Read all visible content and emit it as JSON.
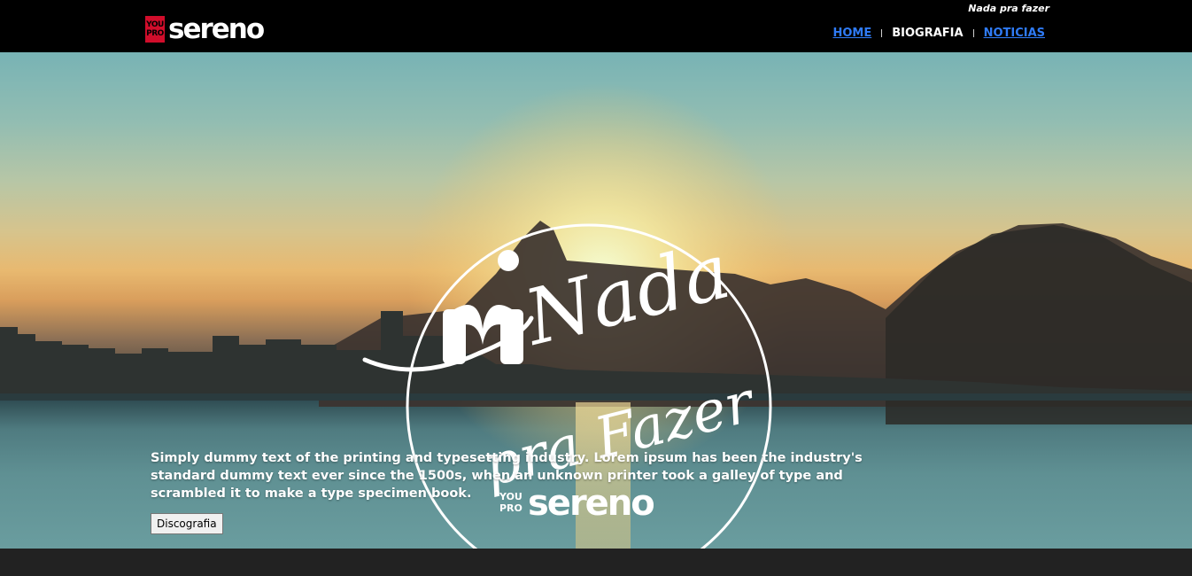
{
  "header": {
    "logo": {
      "badge_top": "YOU",
      "badge_bottom": "PRO",
      "wordmark": "sereno"
    },
    "tagline": "Nada pra fazer",
    "nav": [
      {
        "label": "HOME"
      },
      {
        "label": "BIOGRAFIA"
      },
      {
        "label": "NOTICIAS"
      }
    ]
  },
  "hero": {
    "emblem": {
      "title_line1": "Nada",
      "title_line2": "pra Fazer",
      "badge_top": "YOU",
      "badge_bottom": "PRO",
      "wordmark": "sereno"
    },
    "description": "Simply dummy text of the printing and typesetting industry. Lorem ipsum has been the industry's standard dummy text ever since the 1500s, when an unknown printer took a galley of type and scrambled it to make a type specimen book.",
    "button_label": "Discografia"
  },
  "colors": {
    "header_bg": "#000000",
    "brand_red": "#d10d2b",
    "link_blue": "#2f7bf6",
    "footer_bg": "#222222"
  }
}
